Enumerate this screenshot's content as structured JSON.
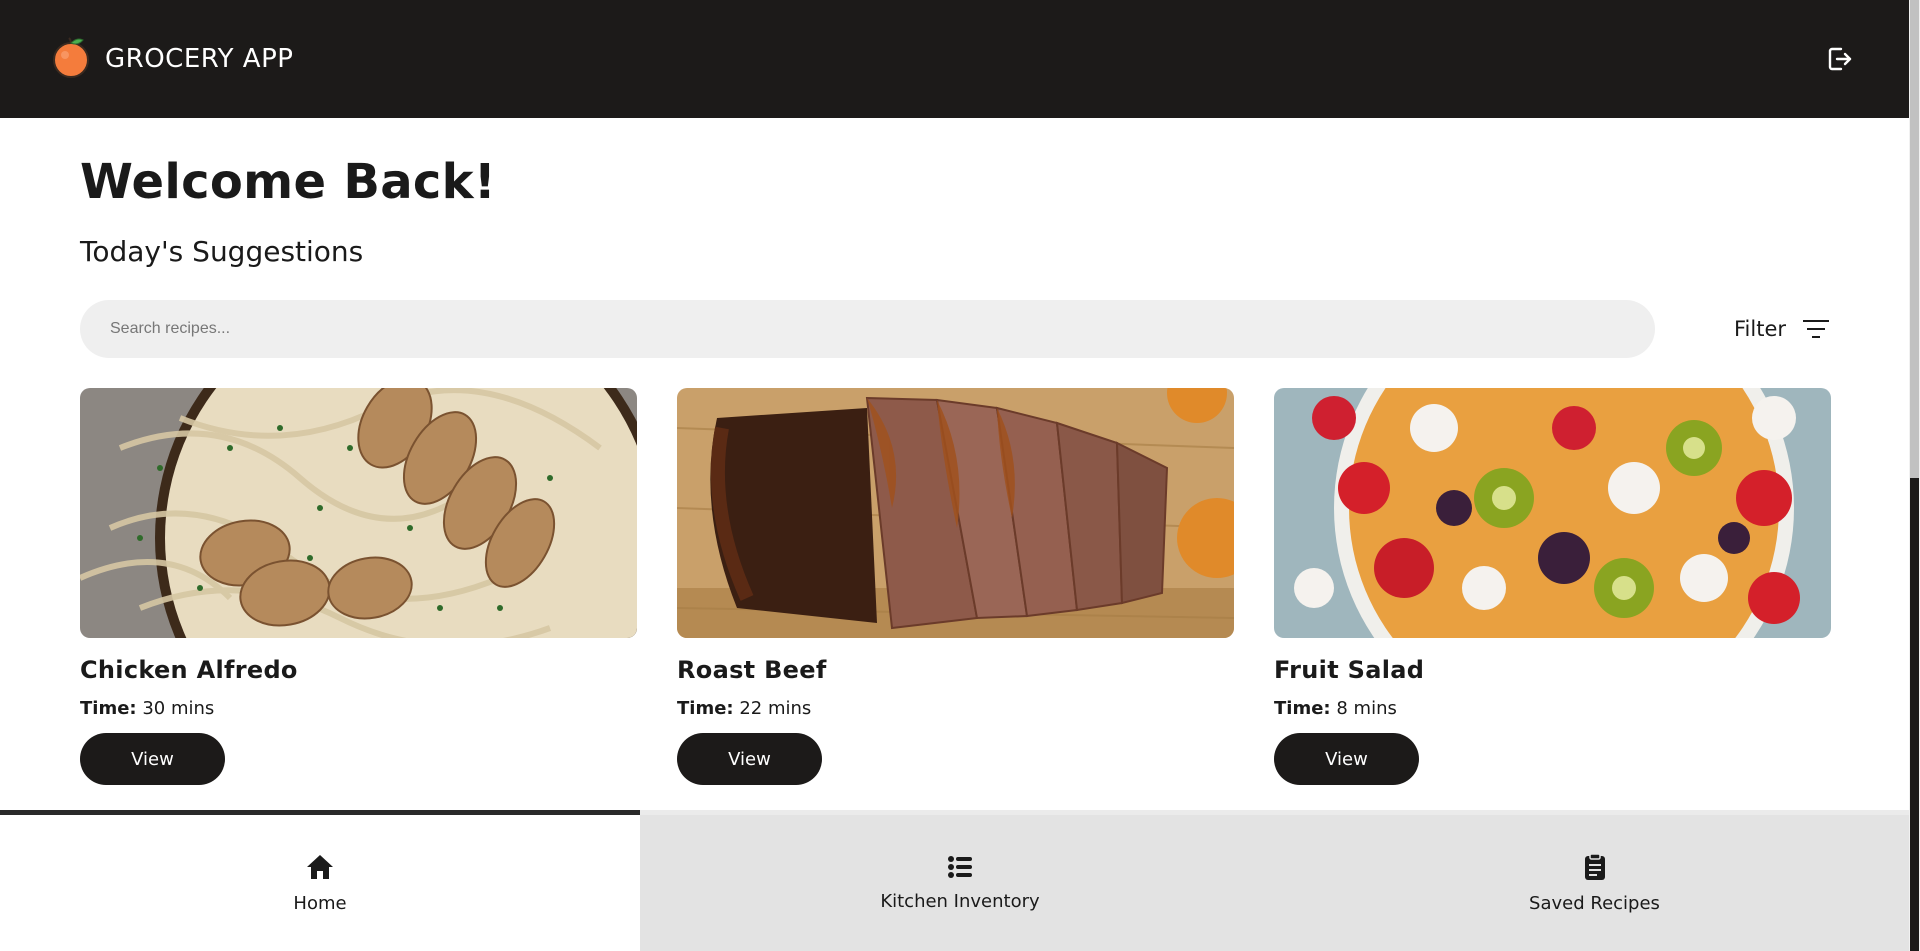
{
  "header": {
    "app_title": "GROCERY APP",
    "logo_icon": "orange-fruit-icon",
    "logout_icon": "logout-icon",
    "background": "#1c1a19"
  },
  "main": {
    "welcome": "Welcome Back!",
    "subtitle": "Today's Suggestions",
    "search_placeholder": "Search recipes...",
    "filter_label": "Filter",
    "filter_icon": "filter-lines-icon"
  },
  "recipes": [
    {
      "name": "Chicken Alfredo",
      "time_label": "Time:",
      "time_value": "30 mins",
      "button": "View",
      "image": "chicken-alfredo-photo"
    },
    {
      "name": "Roast Beef",
      "time_label": "Time:",
      "time_value": "22 mins",
      "button": "View",
      "image": "roast-beef-photo"
    },
    {
      "name": "Fruit Salad",
      "time_label": "Time:",
      "time_value": "8 mins",
      "button": "View",
      "image": "fruit-salad-photo"
    }
  ],
  "bottom_nav": [
    {
      "label": "Home",
      "icon": "home-icon",
      "active": true
    },
    {
      "label": "Kitchen Inventory",
      "icon": "list-icon",
      "active": false
    },
    {
      "label": "Saved Recipes",
      "icon": "clipboard-icon",
      "active": false
    }
  ],
  "colors": {
    "dark": "#1c1a19",
    "search_bg": "#efefef",
    "nav_inactive": "#e3e3e3"
  }
}
